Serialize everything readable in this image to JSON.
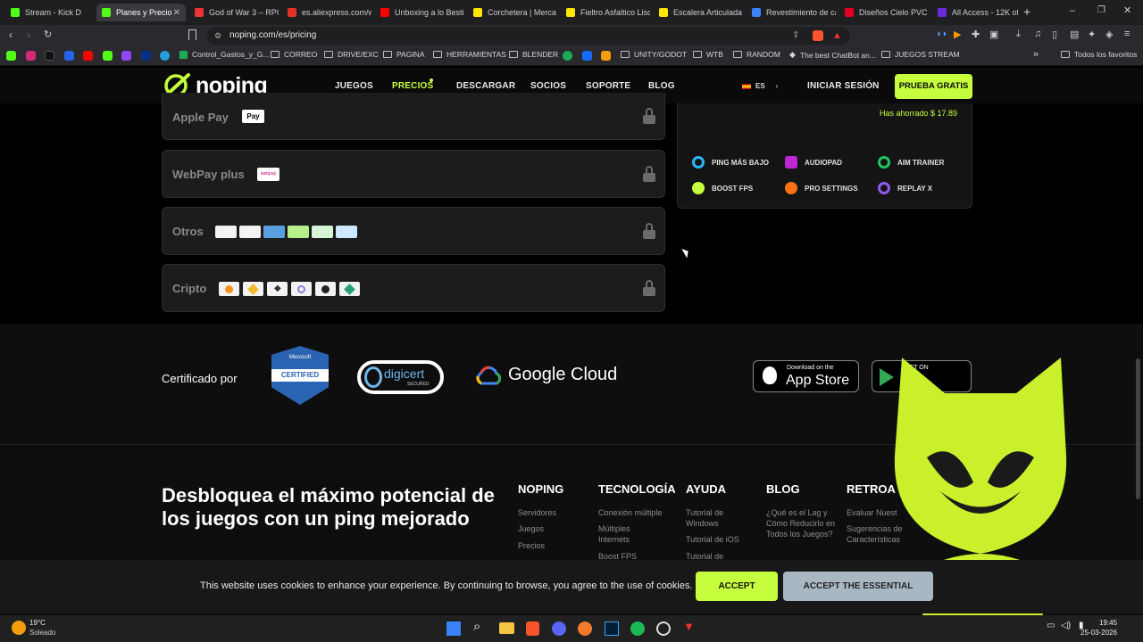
{
  "browser": {
    "tabs": [
      {
        "title": "Stream - Kick D",
        "color": "#53fc18"
      },
      {
        "title": "Planes y Precio",
        "color": "#53fc18"
      },
      {
        "title": "God of War 3 – RPC",
        "color": "#e33"
      },
      {
        "title": "es.aliexpress.com/w",
        "color": "#e43225"
      },
      {
        "title": "Unboxing a lo Besti",
        "color": "#f00"
      },
      {
        "title": "Corchetera | Merca",
        "color": "#ffe600"
      },
      {
        "title": "Fieltro Asfaltico Liso",
        "color": "#ffe600"
      },
      {
        "title": "Escalera Articulada",
        "color": "#ffe600"
      },
      {
        "title": "Revestimiento de ca",
        "color": "#3b82f6"
      },
      {
        "title": "Diseños Cielo PVC -",
        "color": "#e60023"
      },
      {
        "title": "All Access - 12K of",
        "color": "#6d28d9"
      }
    ],
    "url": "noping.com/es/pricing",
    "bookmarks": [
      "Control_Gastos_y_G...",
      "CORREO",
      "DRIVE/EXC",
      "PAGINA",
      "HERRAMIENTAS",
      "BLENDER",
      "UNITY/GODOT",
      "WTB",
      "RANDOM",
      "The best ChatBot an...",
      "JUEGOS STREAM"
    ],
    "bookmarks_all": "Todos los favoritos"
  },
  "nav": {
    "logo": "noping",
    "links": [
      "JUEGOS",
      "PRECIOS",
      "DESCARGAR",
      "SOCIOS",
      "SOPORTE",
      "BLOG"
    ],
    "lang": "ES",
    "login": "INICIAR SESIÓN",
    "cta": "PRUEBA GRATIS"
  },
  "payments": {
    "methods": [
      "Apple Pay",
      "WebPay plus",
      "Otros",
      "Cripto"
    ],
    "applepay_badge": "Pay",
    "webpay_badge": "webpay"
  },
  "plan": {
    "saved": "Has ahorrado $ 17.89",
    "features": [
      "PING MÁS BAJO",
      "AUDIOPAD",
      "AIM TRAINER",
      "BOOST FPS",
      "PRO SETTINGS",
      "REPLAY X"
    ]
  },
  "footer": {
    "certified_label": "Certificado por",
    "ms_top": "Microsoft",
    "ms_badge": "CERTIFIED",
    "digicert": "digicert",
    "digicert_sub": "SECURED",
    "google_cloud": "Google Cloud",
    "appstore_small": "Download on the",
    "appstore_big": "App Store",
    "gplay_small": "GET ON",
    "headline": "Desbloquea el máximo potencial de los juegos con un ping mejorado",
    "columns": [
      {
        "title": "NOPING",
        "links": [
          "Servidores",
          "Juegos",
          "Precios"
        ]
      },
      {
        "title": "TECNOLOGÍA",
        "links": [
          "Conexión múltiple",
          "Múltiples Internets",
          "Boost FPS"
        ]
      },
      {
        "title": "AYUDA",
        "links": [
          "Tutorial de Windows",
          "Tutorial de iOS",
          "Tutorial de"
        ]
      },
      {
        "title": "BLOG",
        "links": [
          "¿Qué es el Lag y Cómo Reducirlo en Todos los Juegos?"
        ]
      },
      {
        "title": "RETROA",
        "links": [
          "Evaluar Nuest",
          "Sugerencias de Características"
        ]
      }
    ]
  },
  "cookie": {
    "text": "This website uses cookies to enhance your experience. By continuing to browse, you agree to the use of cookies.",
    "accept": "ACCEPT",
    "accept_essential": "ACCEPT THE ESSENTIAL"
  },
  "taskbar": {
    "temp": "19°C",
    "weather": "Soleado",
    "time": "19:45",
    "date": "25-03-2026"
  },
  "colors": {
    "accent": "#c6ff3d",
    "mascot": "#c9f02a"
  }
}
